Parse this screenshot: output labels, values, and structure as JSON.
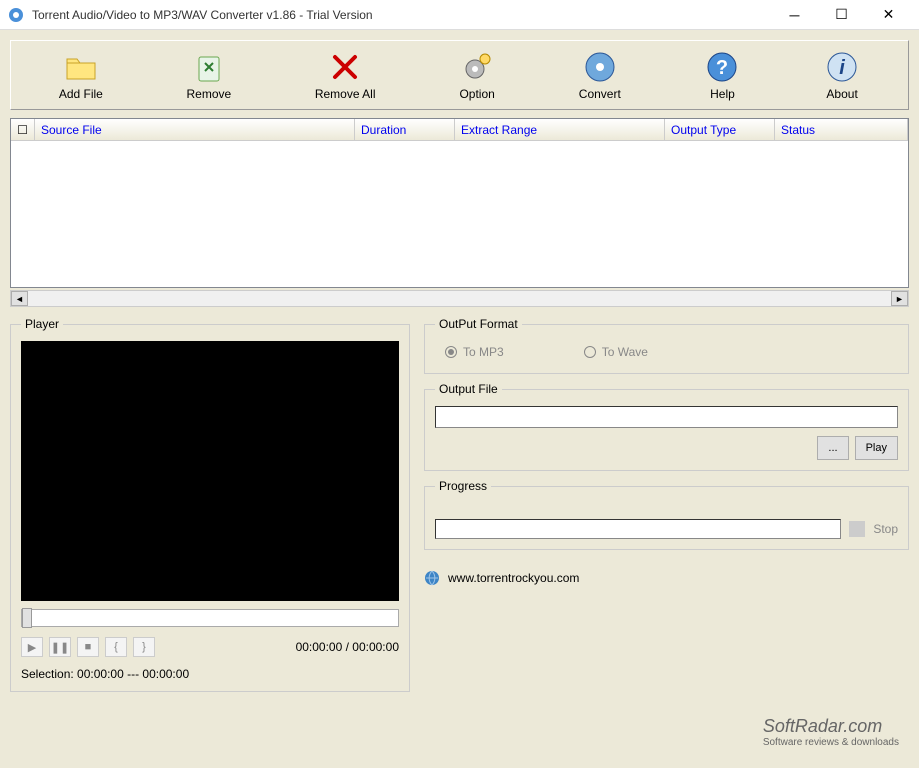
{
  "window": {
    "title": "Torrent Audio/Video to MP3/WAV Converter v1.86 - Trial Version"
  },
  "toolbar": {
    "add_file": "Add File",
    "remove": "Remove",
    "remove_all": "Remove All",
    "option": "Option",
    "convert": "Convert",
    "help": "Help",
    "about": "About"
  },
  "columns": {
    "source_file": "Source File",
    "duration": "Duration",
    "extract_range": "Extract Range",
    "output_type": "Output Type",
    "status": "Status"
  },
  "player": {
    "legend": "Player",
    "time": "00:00:00 / 00:00:00",
    "selection": "Selection: 00:00:00 --- 00:00:00"
  },
  "output_format": {
    "legend": "OutPut Format",
    "to_mp3": "To MP3",
    "to_wave": "To Wave"
  },
  "output_file": {
    "legend": "Output File",
    "browse": "...",
    "play": "Play"
  },
  "progress": {
    "legend": "Progress",
    "stop": "Stop"
  },
  "footer": {
    "url": "www.torrentrockyou.com"
  },
  "watermark": {
    "main": "SoftRadar.com",
    "sub": "Software reviews & downloads"
  }
}
